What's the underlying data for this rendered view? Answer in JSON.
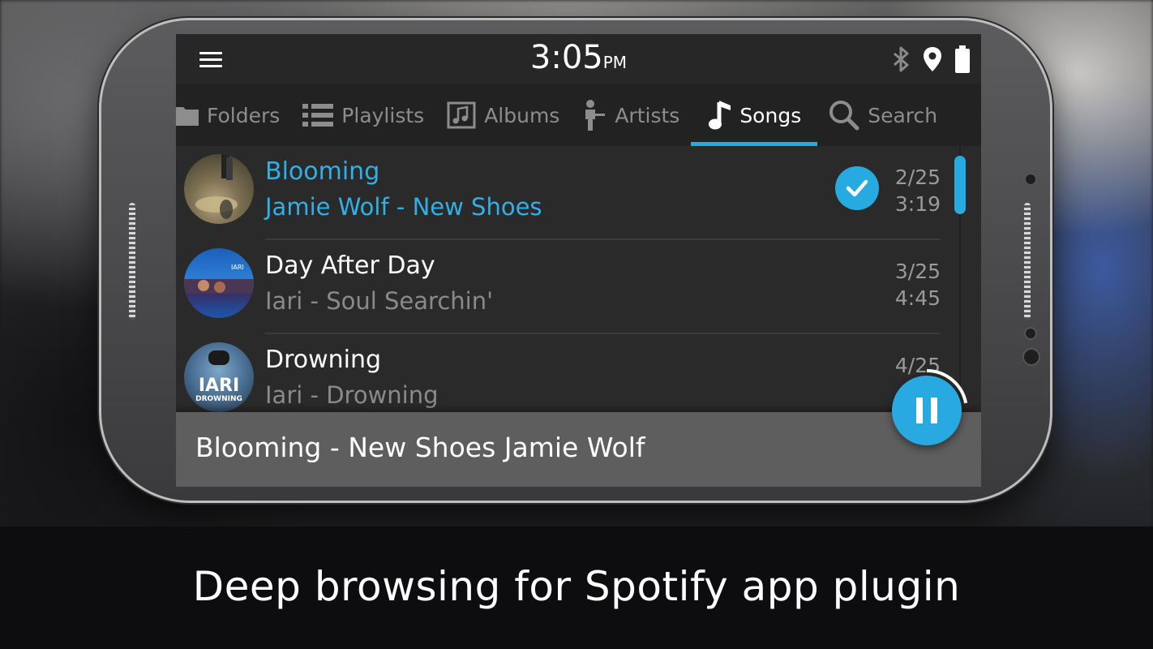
{
  "status_bar": {
    "time": "3:05",
    "ampm": "PM",
    "icons": [
      "bluetooth-icon",
      "location-icon",
      "battery-icon"
    ]
  },
  "tabs": [
    {
      "label": "Folders",
      "icon": "folder-icon",
      "active": false
    },
    {
      "label": "Playlists",
      "icon": "list-icon",
      "active": false
    },
    {
      "label": "Albums",
      "icon": "album-icon",
      "active": false
    },
    {
      "label": "Artists",
      "icon": "artist-icon",
      "active": false
    },
    {
      "label": "Songs",
      "icon": "music-note-icon",
      "active": true
    },
    {
      "label": "Search",
      "icon": "search-icon",
      "active": false
    }
  ],
  "songs": [
    {
      "title": "Blooming",
      "subtitle": "Jamie Wolf - New Shoes",
      "position": "2/25",
      "duration": "3:19",
      "playing": true
    },
    {
      "title": "Day After Day",
      "subtitle": "Iari - Soul Searchin'",
      "position": "3/25",
      "duration": "4:45",
      "playing": false
    },
    {
      "title": "Drowning",
      "subtitle": "Iari - Drowning",
      "position": "4/25",
      "duration": "",
      "playing": false
    }
  ],
  "cover_text": {
    "day_after_day": "IARI",
    "drowning_top": "IARI",
    "drowning_bottom": "DROWNING"
  },
  "now_playing": {
    "text": "Blooming - New Shoes Jamie Wolf",
    "progress": 0.22
  },
  "caption": "Deep browsing for Spotify app plugin",
  "colors": {
    "accent": "#27a9e1"
  }
}
